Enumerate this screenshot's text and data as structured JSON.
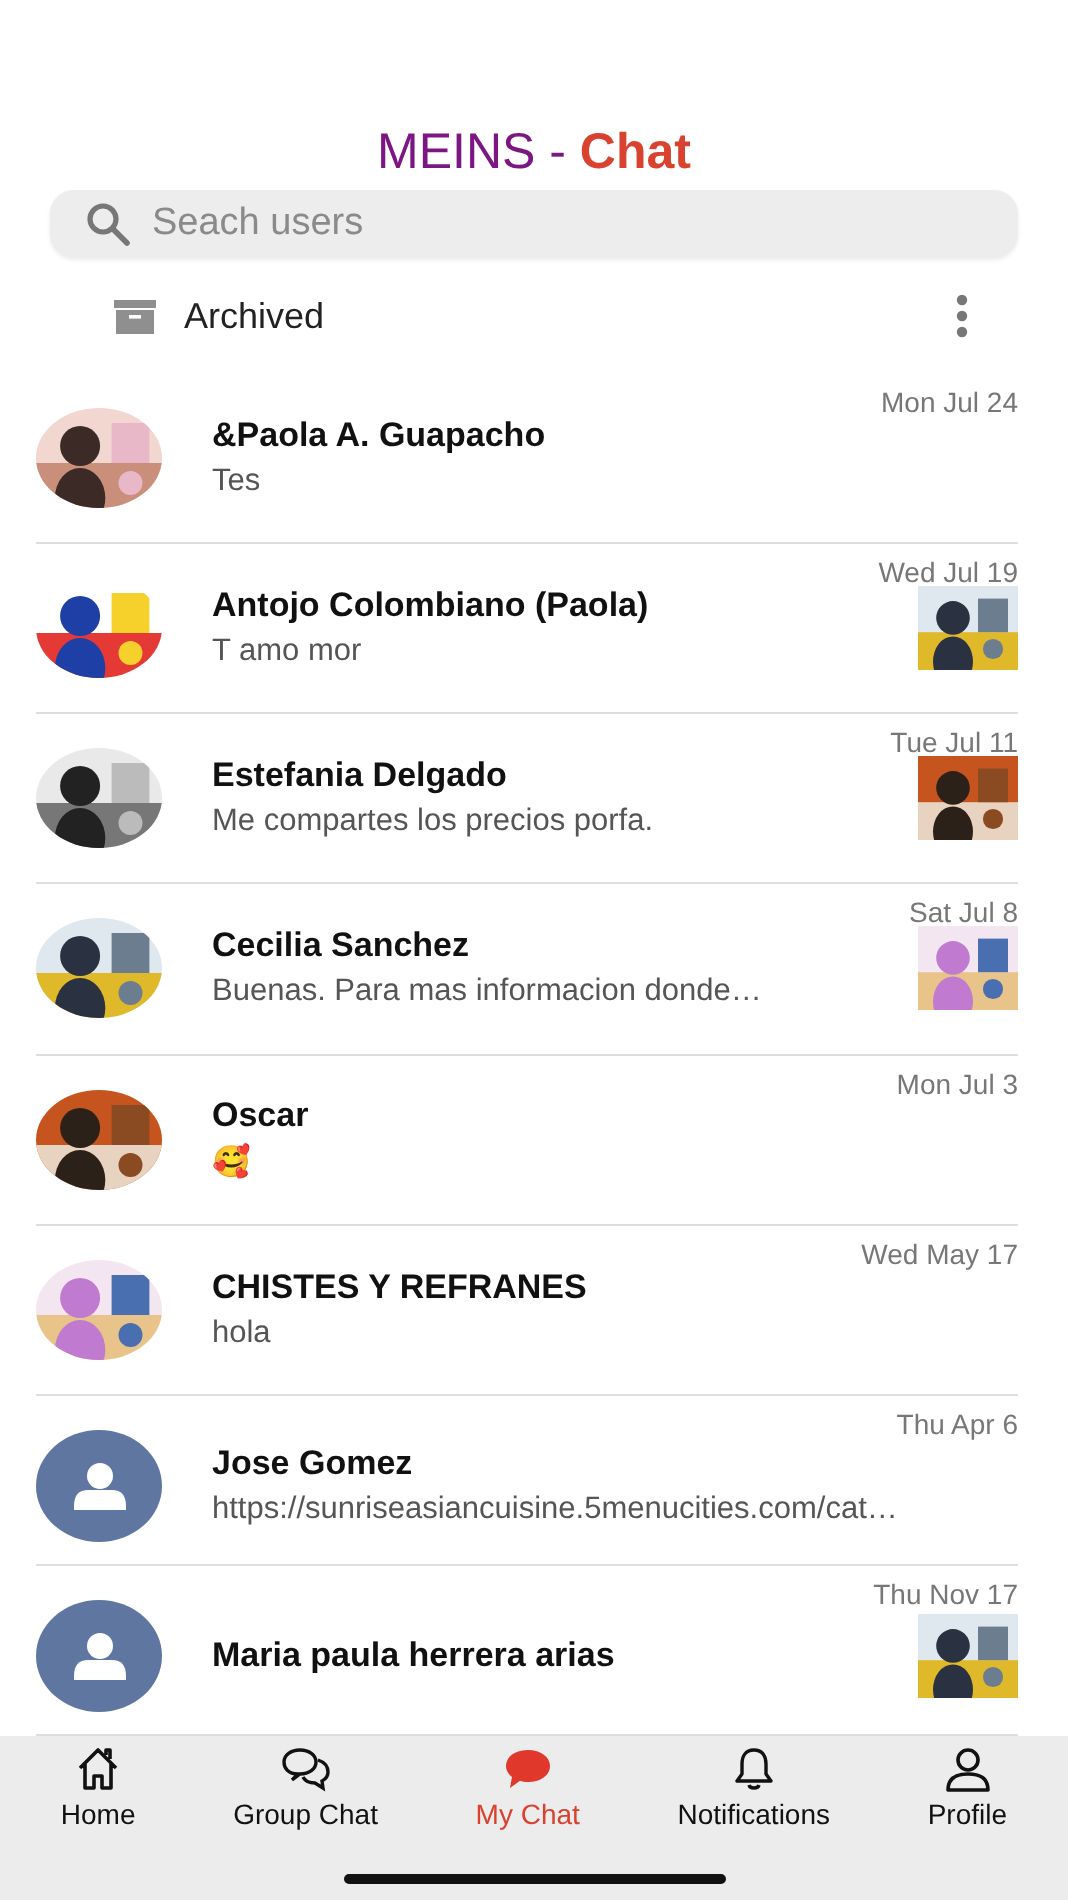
{
  "header": {
    "title_brand": "MEINS -",
    "title_accent": "Chat"
  },
  "search": {
    "placeholder": "Seach users"
  },
  "archived": {
    "label": "Archived"
  },
  "chats": [
    {
      "name": "&Paola A. Guapacho",
      "preview": "Tes",
      "date": "Mon Jul 24",
      "thumbnail": false
    },
    {
      "name": "Antojo Colombiano (Paola)",
      "preview": "T amo mor",
      "date": "Wed Jul 19",
      "thumbnail": true
    },
    {
      "name": "Estefania Delgado",
      "preview": "Me compartes los precios porfa.",
      "date": "Tue Jul 11",
      "thumbnail": true
    },
    {
      "name": "Cecilia Sanchez",
      "preview": "Buenas. Para mas informacion donde…",
      "date": "Sat Jul 8",
      "thumbnail": true
    },
    {
      "name": "Oscar",
      "preview": "🥰",
      "date": "Mon Jul 3",
      "thumbnail": false
    },
    {
      "name": "CHISTES Y REFRANES",
      "preview": "hola",
      "date": "Wed May 17",
      "thumbnail": false
    },
    {
      "name": "Jose Gomez",
      "preview": "https://sunriseasiancuisine.5menucities.com/cat…",
      "date": "Thu Apr 6",
      "kind": "default",
      "thumbnail": false
    },
    {
      "name": "Maria paula herrera arias",
      "date": "Thu Nov 17",
      "kind": "default",
      "thumbnail": true
    }
  ],
  "tabs": [
    {
      "label": "Home",
      "selected": false
    },
    {
      "label": "Group Chat",
      "selected": false
    },
    {
      "label": "My Chat",
      "selected": true
    },
    {
      "label": "Notifications",
      "selected": false
    },
    {
      "label": "Profile",
      "selected": false
    }
  ]
}
